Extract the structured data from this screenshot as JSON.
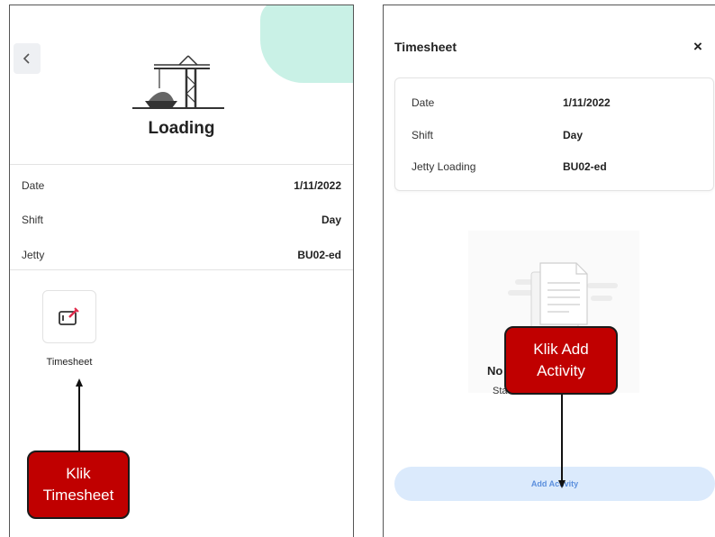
{
  "left_screen": {
    "title": "Loading",
    "info": [
      {
        "label": "Date",
        "value": "1/11/2022"
      },
      {
        "label": "Shift",
        "value": "Day"
      },
      {
        "label": "Jetty",
        "value": "BU02-ed"
      }
    ],
    "timesheet_label": "Timesheet",
    "icons": {
      "back": "chevron-left-icon",
      "crane": "crane-icon",
      "timesheet": "edit-form-icon"
    }
  },
  "right_screen": {
    "title": "Timesheet",
    "close_symbol": "×",
    "info": [
      {
        "label": "Date",
        "value": "1/11/2022"
      },
      {
        "label": "Shift",
        "value": "Day"
      },
      {
        "label": "Jetty Loading",
        "value": "BU02-ed"
      }
    ],
    "empty_title_partial": "No",
    "empty_sub_partial": "Sta",
    "add_button_label": "Add Activity",
    "accent_color": "#5b8fdd",
    "button_bg_color": "#dbeafc"
  },
  "annotations": {
    "left": {
      "line1": "Klik",
      "line2": "Timesheet"
    },
    "right": {
      "line1": "Klik Add",
      "line2": "Activity"
    },
    "callout_color": "#c00000"
  }
}
